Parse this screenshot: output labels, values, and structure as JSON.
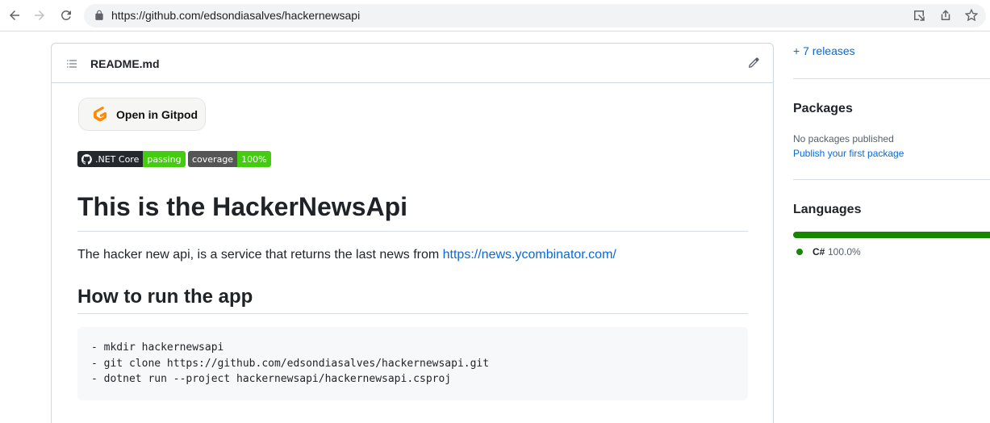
{
  "browser": {
    "url": "https://github.com/edsondiasalves/hackernewsapi"
  },
  "readme": {
    "title": "README.md",
    "gitpod_label": "Open in Gitpod",
    "badges": [
      {
        "label": ".NET Core",
        "value": "passing",
        "color": "#44cc11"
      },
      {
        "label": "coverage",
        "value": "100%",
        "color": "#44cc11"
      }
    ],
    "heading": "This is the HackerNewsApi",
    "description": "The hacker new api, is a service that returns the last news from ",
    "description_link": "https://news.ycombinator.com/",
    "run_heading": "How to run the app",
    "code_lines": [
      "- mkdir hackernewsapi",
      "- git clone https://github.com/edsondiasalves/hackernewsapi.git",
      "- dotnet run --project hackernewsapi/hackernewsapi.csproj"
    ]
  },
  "sidebar": {
    "releases_link": "+ 7 releases",
    "packages_heading": "Packages",
    "packages_empty": "No packages published",
    "packages_link": "Publish your first package",
    "languages_heading": "Languages",
    "languages": [
      {
        "name": "C#",
        "percent": "100.0%",
        "color": "#178600"
      }
    ]
  },
  "colors": {
    "link": "#0969da",
    "border": "#d0d7de",
    "gitpod_orange": "#ff8a00"
  }
}
